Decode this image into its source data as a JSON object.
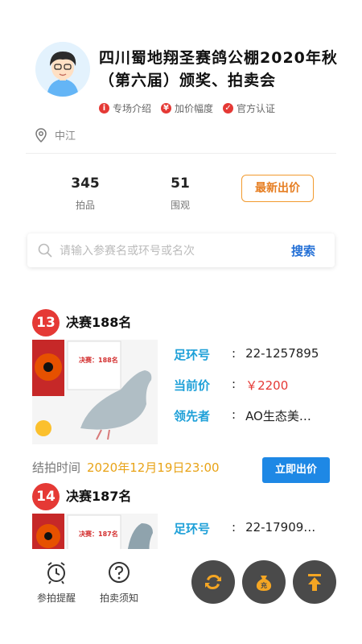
{
  "header": {
    "title": "四川蜀地翔圣赛鸽公棚2020年秋（第六届）颁奖、拍卖会",
    "badges": [
      "专场介绍",
      "加价幅度",
      "官方认证"
    ],
    "location": "中江"
  },
  "stats": [
    {
      "value": "345",
      "label": "拍品"
    },
    {
      "value": "51",
      "label": "围观"
    }
  ],
  "new_bid_label": "最新出价",
  "search": {
    "placeholder": "请输入参赛名或环号或名次",
    "button": "搜索"
  },
  "items": [
    {
      "rank": "13",
      "title": "决赛188名",
      "ring_label": "足环号",
      "ring": "22-1257895",
      "price_label": "当前价",
      "price": "￥2200",
      "leader_label": "领先者",
      "leader": "AO生态美…",
      "end_label": "结拍时间",
      "end_time": "2020年12月19日23:00",
      "bid_button": "立即出价",
      "photo_caption": "决赛：188名"
    },
    {
      "rank": "14",
      "title": "决赛187名",
      "ring_label": "足环号",
      "ring": "22-17909…",
      "photo_caption": "决赛：187名"
    }
  ],
  "bottom": {
    "remind": "参拍提醒",
    "notice": "拍卖须知"
  },
  "colors": {
    "accent": "#e53935",
    "blue": "#1e88e5",
    "orange": "#e67e22"
  }
}
